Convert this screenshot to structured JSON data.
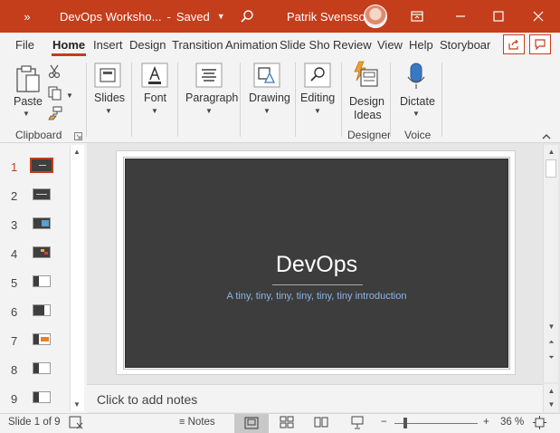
{
  "titlebar": {
    "qat_label": "»",
    "doc_title": "DevOps Worksho...",
    "save_status": "Saved",
    "user_name": "Patrik Svensson"
  },
  "tabs": [
    {
      "label": "File"
    },
    {
      "label": "Home"
    },
    {
      "label": "Insert"
    },
    {
      "label": "Design"
    },
    {
      "label": "Transition"
    },
    {
      "label": "Animation"
    },
    {
      "label": "Slide Sho"
    },
    {
      "label": "Review"
    },
    {
      "label": "View"
    },
    {
      "label": "Help"
    },
    {
      "label": "Storyboar"
    }
  ],
  "ribbon": {
    "paste": "Paste",
    "slides": "Slides",
    "font": "Font",
    "paragraph": "Paragraph",
    "drawing": "Drawing",
    "editing": "Editing",
    "design_ideas_1": "Design",
    "design_ideas_2": "Ideas",
    "dictate": "Dictate",
    "groups": {
      "clipboard": "Clipboard",
      "designer": "Designer",
      "voice": "Voice"
    }
  },
  "thumbnails": [
    {
      "num": "1"
    },
    {
      "num": "2"
    },
    {
      "num": "3"
    },
    {
      "num": "4"
    },
    {
      "num": "5"
    },
    {
      "num": "6"
    },
    {
      "num": "7"
    },
    {
      "num": "8"
    },
    {
      "num": "9"
    }
  ],
  "slide": {
    "title": "DevOps",
    "subtitle": "A tiny, tiny, tiny, tiny, tiny, tiny introduction"
  },
  "notes": {
    "placeholder": "Click to add notes"
  },
  "status": {
    "slide_info": "Slide 1 of 9",
    "notes_label": "Notes",
    "zoom_minus": "−",
    "zoom_plus": "+",
    "zoom_level": "36 %"
  },
  "colors": {
    "accent": "#c43e1c",
    "slide_bg": "#3d3d3d",
    "subtitle": "#8ab4e8"
  }
}
